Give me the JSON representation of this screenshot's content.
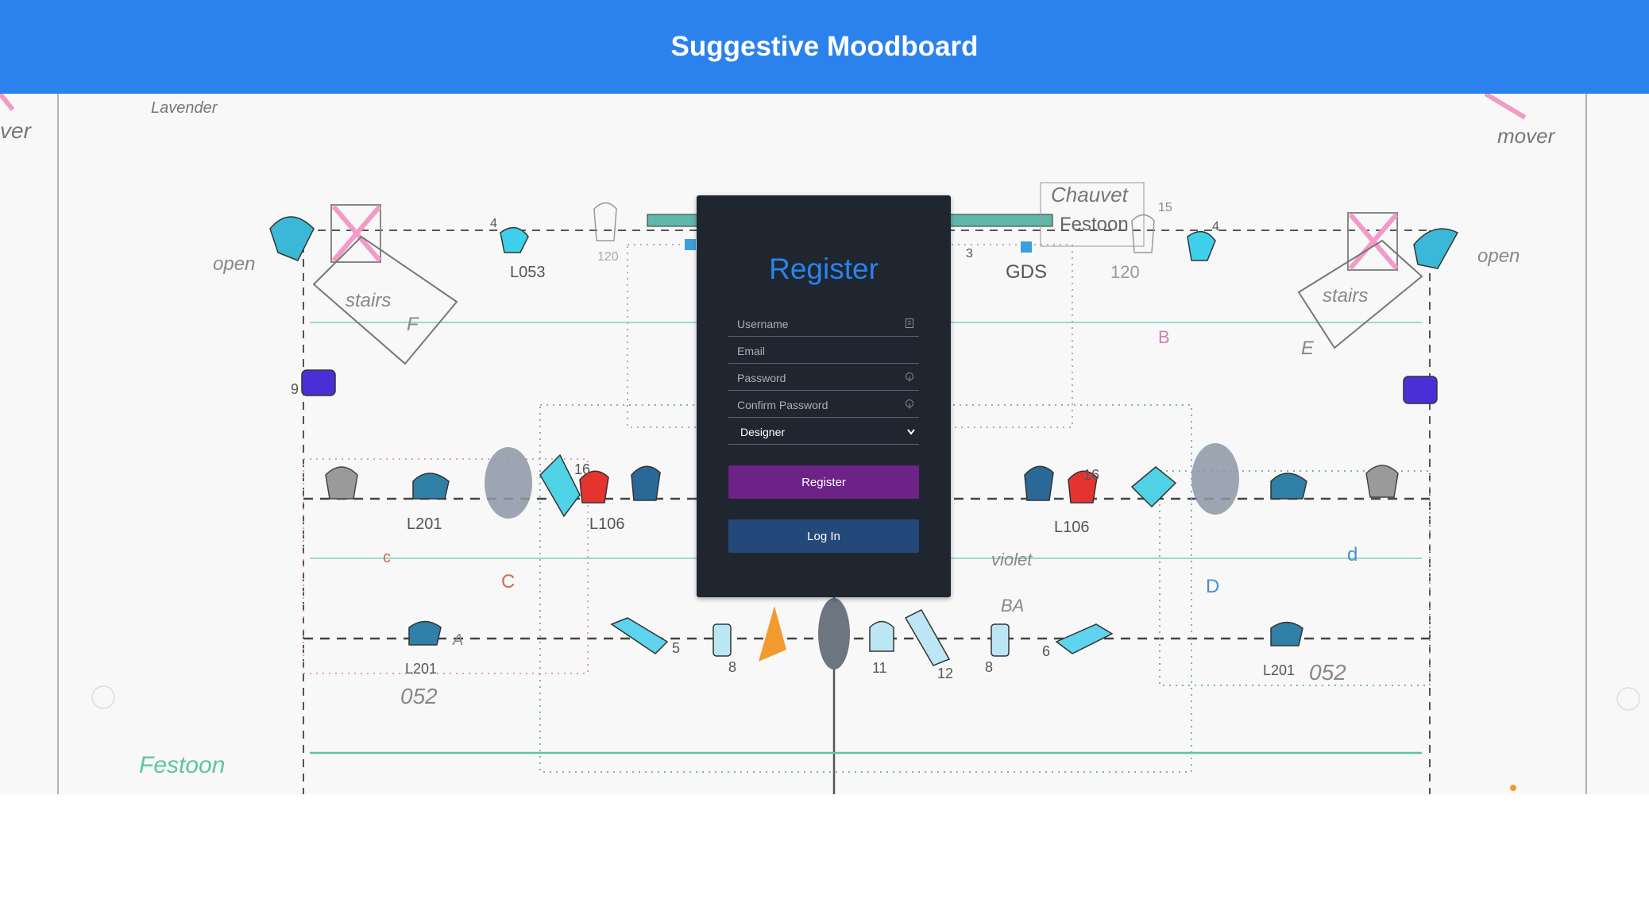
{
  "header": {
    "title": "Suggestive Moodboard"
  },
  "background": {
    "sketch_labels": {
      "lavender": "Lavender",
      "mover_left": "ver",
      "mover_right": "mover",
      "open_left": "open",
      "open_right": "open",
      "stairs_left": "stairs",
      "stairs_right": "stairs",
      "f_label": "F",
      "e_label": "E",
      "chauvet": "Chauvet",
      "festoon_top": "Festoon",
      "festoon_bottom": "Festoon",
      "l053": "L053",
      "gds": "GDS",
      "num_4a": "4",
      "num_4b": "4",
      "num_3": "3",
      "num_15": "15",
      "num_120a": "120",
      "num_120b": "120",
      "b_label": "B",
      "num_9": "9",
      "l201a": "L201",
      "l106a": "L106",
      "l106b": "L106",
      "num_16a": "16",
      "num_16b": "16",
      "c_small": "c",
      "c_big": "C",
      "d_small": "d",
      "d_big": "D",
      "violet": "violet",
      "l201b": "L201",
      "l201c": "L201",
      "num_052a": "052",
      "num_052b": "052",
      "num_5": "5",
      "num_8a": "8",
      "num_8b": "8",
      "num_11": "11",
      "num_12": "12",
      "num_6": "6",
      "ba": "BA",
      "a_small": "A"
    }
  },
  "register": {
    "title": "Register",
    "username_placeholder": "Username",
    "email_placeholder": "Email",
    "password_placeholder": "Password",
    "confirm_password_placeholder": "Confirm Password",
    "role_value": "Designer",
    "register_label": "Register",
    "login_label": "Log In"
  },
  "colors": {
    "header_bg": "#2b82ec",
    "panel_bg": "#1f2630",
    "register_button": "#6c2286",
    "login_button": "#23497a"
  }
}
